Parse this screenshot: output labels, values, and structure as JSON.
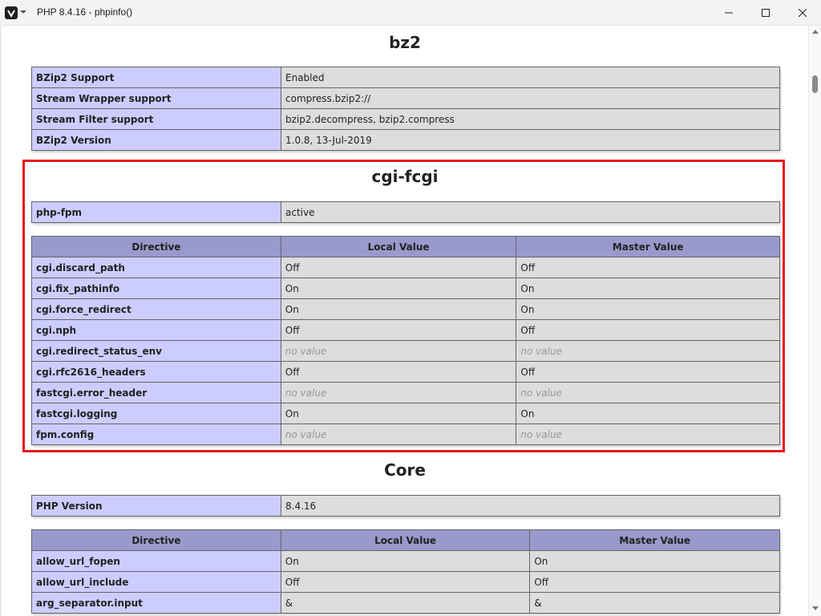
{
  "window": {
    "title": "PHP 8.4.16 - phpinfo()"
  },
  "sections": {
    "bz2": {
      "heading": "bz2",
      "rows": [
        {
          "name": "BZip2 Support",
          "value": "Enabled"
        },
        {
          "name": "Stream Wrapper support",
          "value": "compress.bzip2://"
        },
        {
          "name": "Stream Filter support",
          "value": "bzip2.decompress, bzip2.compress"
        },
        {
          "name": "BZip2 Version",
          "value": "1.0.8, 13-Jul-2019"
        }
      ]
    },
    "cgi_fcgi": {
      "heading": "cgi-fcgi",
      "info_rows": [
        {
          "name": "php-fpm",
          "value": "active"
        }
      ],
      "directive_headers": [
        "Directive",
        "Local Value",
        "Master Value"
      ],
      "directives": [
        {
          "name": "cgi.discard_path",
          "local": "Off",
          "master": "Off"
        },
        {
          "name": "cgi.fix_pathinfo",
          "local": "On",
          "master": "On"
        },
        {
          "name": "cgi.force_redirect",
          "local": "On",
          "master": "On"
        },
        {
          "name": "cgi.nph",
          "local": "Off",
          "master": "Off"
        },
        {
          "name": "cgi.redirect_status_env",
          "local": "no value",
          "master": "no value"
        },
        {
          "name": "cgi.rfc2616_headers",
          "local": "Off",
          "master": "Off"
        },
        {
          "name": "fastcgi.error_header",
          "local": "no value",
          "master": "no value"
        },
        {
          "name": "fastcgi.logging",
          "local": "On",
          "master": "On"
        },
        {
          "name": "fpm.config",
          "local": "no value",
          "master": "no value"
        }
      ]
    },
    "core": {
      "heading": "Core",
      "info_rows": [
        {
          "name": "PHP Version",
          "value": "8.4.16"
        }
      ],
      "directive_headers": [
        "Directive",
        "Local Value",
        "Master Value"
      ],
      "directives": [
        {
          "name": "allow_url_fopen",
          "local": "On",
          "master": "On"
        },
        {
          "name": "allow_url_include",
          "local": "Off",
          "master": "Off"
        },
        {
          "name": "arg_separator.input",
          "local": "&",
          "master": "&"
        }
      ]
    }
  },
  "colors": {
    "header_bg": "#9999cc",
    "name_cell_bg": "#ccccff",
    "value_cell_bg": "#dddddd",
    "highlight_border": "#e8141c"
  }
}
